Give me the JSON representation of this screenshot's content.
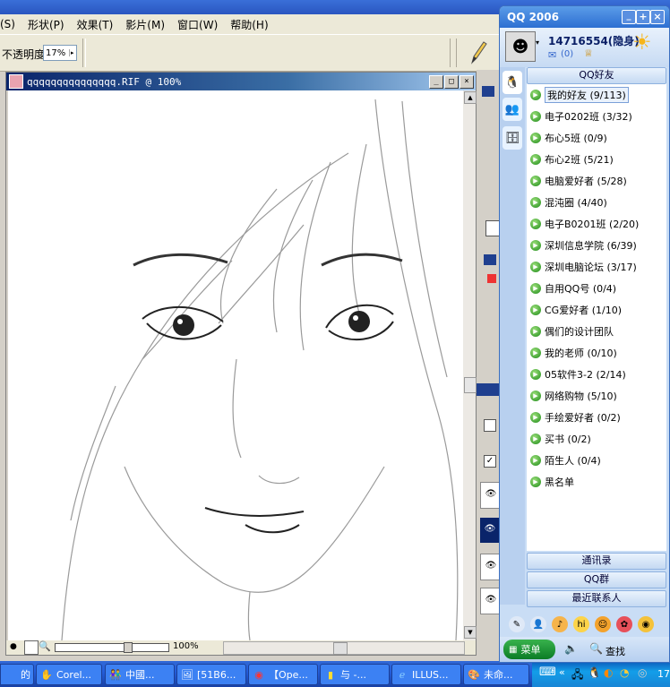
{
  "menubar": {
    "items": [
      "(S)",
      "形状(P)",
      "效果(T)",
      "影片(M)",
      "窗口(W)",
      "帮助(H)"
    ]
  },
  "propbar": {
    "opacity_label": "不透明度:",
    "opacity_value": "17%"
  },
  "document": {
    "title": "qqqqqqqqqqqqqqq.RIF @ 100%",
    "zoom": "100%"
  },
  "qq": {
    "title": "QQ 2006",
    "user": "14716554(隐身)",
    "mail_count": "(0)",
    "tab_header": "QQ好友",
    "groups": [
      {
        "label": "我的好友 (9/113)",
        "selected": true
      },
      {
        "label": "电子0202班 (3/32)"
      },
      {
        "label": "布心5班 (0/9)"
      },
      {
        "label": "布心2班 (5/21)"
      },
      {
        "label": "电脑爱好者 (5/28)"
      },
      {
        "label": "混沌圈 (4/40)"
      },
      {
        "label": "电子B0201班 (2/20)"
      },
      {
        "label": "深圳信息学院 (6/39)"
      },
      {
        "label": "深圳电脑论坛 (3/17)"
      },
      {
        "label": "自用QQ号 (0/4)"
      },
      {
        "label": "CG爱好者 (1/10)"
      },
      {
        "label": "偶们的设计团队"
      },
      {
        "label": "我的老师 (0/10)"
      },
      {
        "label": "05软件3-2 (2/14)"
      },
      {
        "label": "网络购物 (5/10)"
      },
      {
        "label": "手绘爱好者 (0/2)"
      },
      {
        "label": "买书 (0/2)"
      },
      {
        "label": "陌生人 (0/4)"
      },
      {
        "label": "黑名单"
      }
    ],
    "bottom_tabs": [
      "通讯录",
      "QQ群",
      "最近联系人"
    ],
    "menu_label": "菜单",
    "search_label": "查找"
  },
  "taskbar": {
    "tasks": [
      {
        "label": "的",
        "icon": "app-icon"
      },
      {
        "label": "Corel...",
        "icon": "corel-icon"
      },
      {
        "label": "中國...",
        "icon": "people-icon"
      },
      {
        "label": "[51B6...",
        "icon": "picture-icon"
      },
      {
        "label": "【Ope...",
        "icon": "opera-icon"
      },
      {
        "label": "与 -...",
        "icon": "chat-icon"
      },
      {
        "label": "ILLUS...",
        "icon": "ie-icon"
      },
      {
        "label": "未命...",
        "icon": "paint-icon"
      }
    ],
    "clock": "17"
  }
}
